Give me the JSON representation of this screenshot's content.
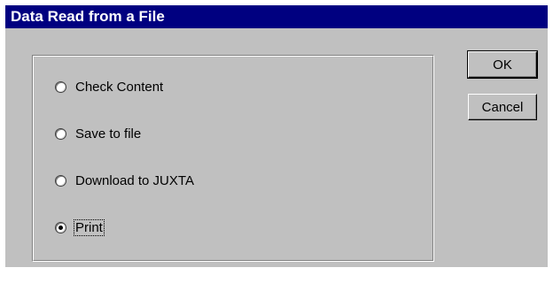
{
  "dialog": {
    "title": "Data Read from a File"
  },
  "options": [
    {
      "label": "Check Content",
      "checked": false
    },
    {
      "label": "Save to file",
      "checked": false
    },
    {
      "label": "Download to JUXTA",
      "checked": false
    },
    {
      "label": "Print",
      "checked": true
    }
  ],
  "buttons": {
    "ok_label": "OK",
    "cancel_label": "Cancel"
  },
  "colors": {
    "title_bar": "#000080",
    "dialog_face": "#c0c0c0"
  }
}
